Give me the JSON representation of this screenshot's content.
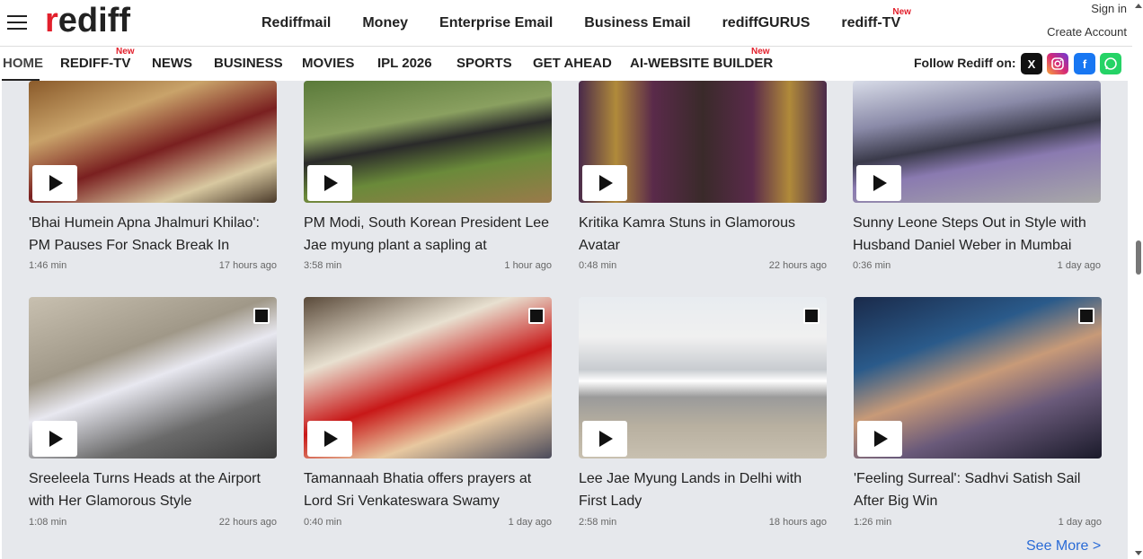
{
  "header": {
    "logo": "rediff",
    "links": [
      "Rediffmail",
      "Money",
      "Enterprise Email",
      "Business Email",
      "rediffGURUS",
      "rediff-TV"
    ],
    "new_tag": "New",
    "signin": "Sign in",
    "create_account": "Create Account"
  },
  "nav": {
    "items": [
      "HOME",
      "REDIFF-TV",
      "NEWS",
      "BUSINESS",
      "MOVIES",
      "IPL 2026",
      "SPORTS",
      "GET AHEAD",
      "AI-WEBSITE BUILDER"
    ],
    "new_tag": "New",
    "follow": "Follow Rediff on:",
    "social_icons": [
      "x-icon",
      "instagram-icon",
      "facebook-icon",
      "whatsapp-icon"
    ]
  },
  "videos": [
    {
      "title": "'Bhai Humein Apna Jhalmuri Khilao': PM Pauses For Snack Break In",
      "duration": "1:46 min",
      "age": "17 hours ago"
    },
    {
      "title": "PM Modi, South Korean President Lee Jae myung plant a sapling at",
      "duration": "3:58 min",
      "age": "1 hour ago"
    },
    {
      "title": "Kritika Kamra Stuns in Glamorous Avatar",
      "duration": "0:48 min",
      "age": "22 hours ago"
    },
    {
      "title": "Sunny Leone Steps Out in Style with Husband Daniel Weber in Mumbai",
      "duration": "0:36 min",
      "age": "1 day ago"
    },
    {
      "title": "Sreeleela Turns Heads at the Airport with Her Glamorous Style",
      "duration": "1:08 min",
      "age": "22 hours ago"
    },
    {
      "title": "Tamannaah Bhatia offers prayers at Lord Sri Venkateswara Swamy",
      "duration": "0:40 min",
      "age": "1 day ago"
    },
    {
      "title": "Lee Jae Myung Lands in Delhi with First Lady",
      "duration": "2:58 min",
      "age": "18 hours ago"
    },
    {
      "title": "'Feeling Surreal': Sadhvi Satish Sail After Big Win",
      "duration": "1:26 min",
      "age": "1 day ago"
    }
  ],
  "see_more": "See More >",
  "colors": {
    "brand_red": "#e2202c",
    "link_blue": "#2a6bd6",
    "panel_bg": "#e6e8ec"
  }
}
